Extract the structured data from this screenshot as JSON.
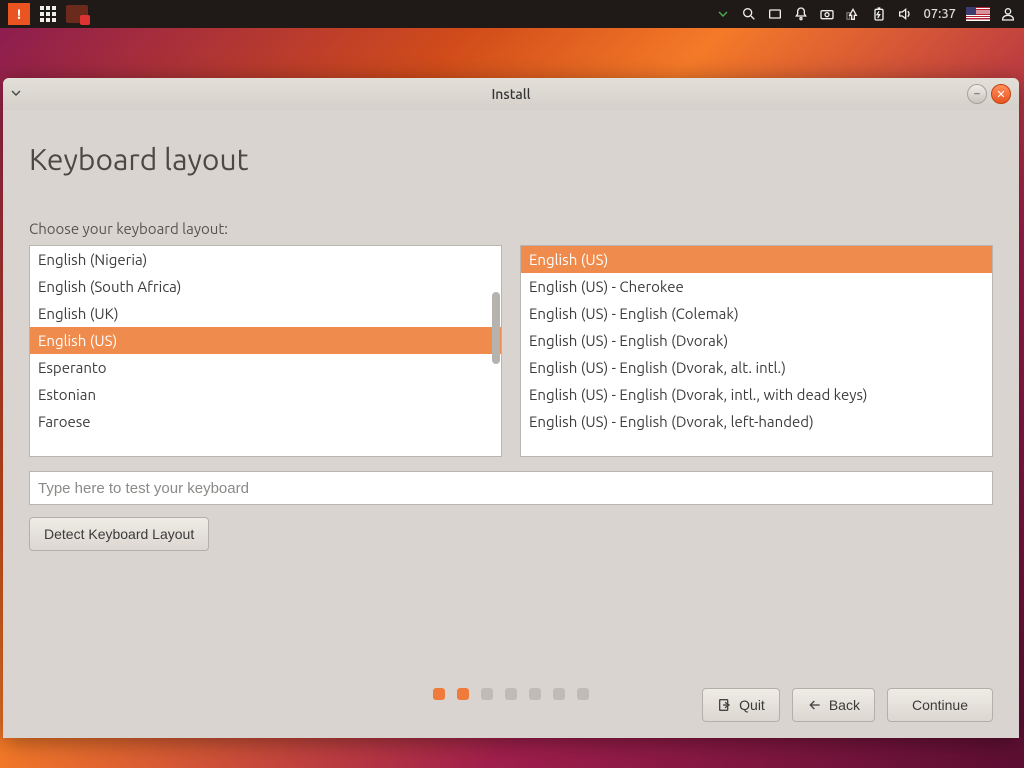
{
  "panel": {
    "time": "07:37"
  },
  "window": {
    "title": "Install",
    "heading": "Keyboard layout",
    "subhead": "Choose your keyboard layout:",
    "layouts_left": [
      "English (Nigeria)",
      "English (South Africa)",
      "English (UK)",
      "English (US)",
      "Esperanto",
      "Estonian",
      "Faroese"
    ],
    "left_selected_index": 3,
    "variants_right": [
      "English (US)",
      "English (US) - Cherokee",
      "English (US) - English (Colemak)",
      "English (US) - English (Dvorak)",
      "English (US) - English (Dvorak, alt. intl.)",
      "English (US) - English (Dvorak, intl., with dead keys)",
      "English (US) - English (Dvorak, left-handed)"
    ],
    "right_selected_index": 0,
    "test_placeholder": "Type here to test your keyboard",
    "detect_label": "Detect Keyboard Layout",
    "quit_label": "Quit",
    "back_label": "Back",
    "continue_label": "Continue",
    "progress_total": 7,
    "progress_current": 2
  }
}
